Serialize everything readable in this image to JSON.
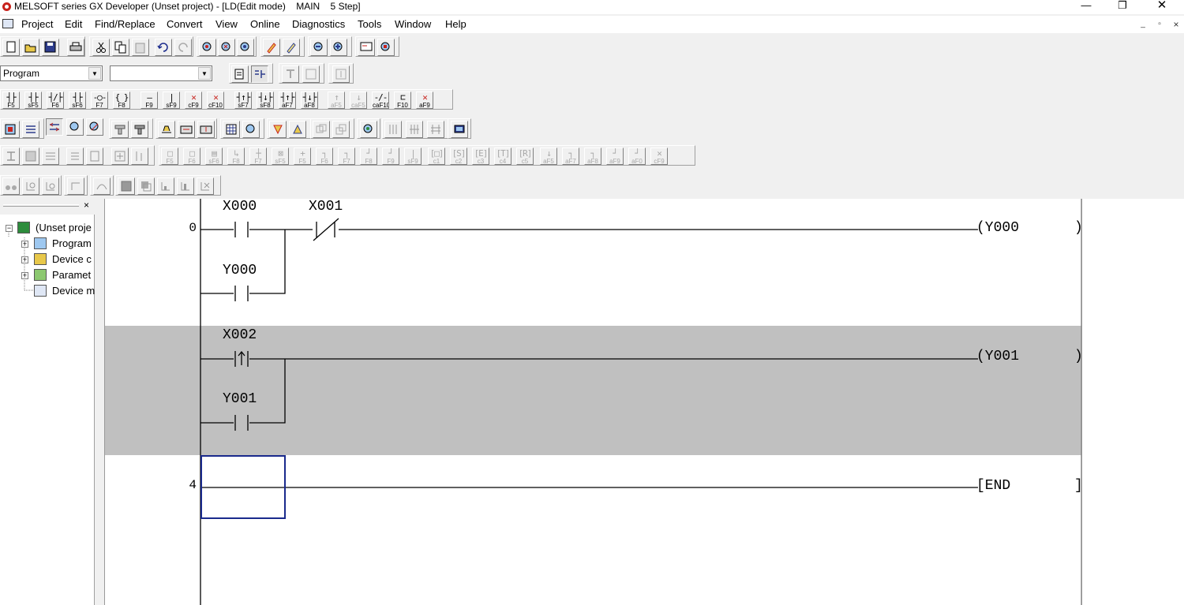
{
  "window": {
    "title": "MELSOFT series GX Developer (Unset project) - [LD(Edit mode)    MAIN    5 Step]",
    "minimize": "—",
    "restore": "❐",
    "close": "✕",
    "mdi_minimize": "_",
    "mdi_restore": "▫",
    "mdi_close": "×"
  },
  "menu": [
    "Project",
    "Edit",
    "Find/Replace",
    "Convert",
    "View",
    "Online",
    "Diagnostics",
    "Tools",
    "Window",
    "Help"
  ],
  "toolbar_combo": {
    "program_value": "Program",
    "second_value": "",
    "arrow": "▼"
  },
  "ladder_keys": [
    {
      "glyph": "┤├",
      "key": "F5"
    },
    {
      "glyph": "┤├",
      "key": "sF5"
    },
    {
      "glyph": "┤/├",
      "key": "F6"
    },
    {
      "glyph": "┤├",
      "key": "sF6"
    },
    {
      "glyph": "-○-",
      "key": "F7"
    },
    {
      "glyph": "{ }",
      "key": "F8"
    },
    {
      "glyph": "—",
      "key": "F9"
    },
    {
      "glyph": "|",
      "key": "sF9"
    },
    {
      "glyph": "✕",
      "key": "cF9"
    },
    {
      "glyph": "✕",
      "key": "cF10"
    },
    {
      "glyph": "┤↑├",
      "key": "sF7"
    },
    {
      "glyph": "┤↓├",
      "key": "sF8"
    },
    {
      "glyph": "┤↑├",
      "key": "aF7"
    },
    {
      "glyph": "┤↓├",
      "key": "aF8"
    },
    {
      "glyph": "↑",
      "key": "aF5"
    },
    {
      "glyph": "↓",
      "key": "caF5"
    },
    {
      "glyph": "-/-",
      "key": "caF10"
    },
    {
      "glyph": "⊏",
      "key": "F10"
    },
    {
      "glyph": "✕",
      "key": "aF9"
    }
  ],
  "sfc_keys": [
    "F5",
    "F6",
    "sF6",
    "F8",
    "F7",
    "sF5",
    "F5",
    "F6",
    "F7",
    "F8",
    "F9",
    "sF9",
    "c1",
    "c2",
    "c3",
    "c4",
    "c5",
    "aF5",
    "aF7",
    "aF8",
    "aF9",
    "aF0",
    "cF9"
  ],
  "tree": {
    "close": "×",
    "root": "(Unset proje",
    "children": [
      "Program",
      "Device c",
      "Paramet",
      "Device m"
    ],
    "expand": "+",
    "collapse": "−"
  },
  "ladder": {
    "rungs": [
      {
        "step": "0",
        "contacts": [
          {
            "label": "X000",
            "type": "NO"
          },
          {
            "label": "X001",
            "type": "NC"
          },
          {
            "label": "Y000",
            "type": "NO",
            "branch": true
          }
        ],
        "coil": "(Y000",
        "coil_end": ")"
      },
      {
        "step": "",
        "contacts": [
          {
            "label": "X002",
            "type": "rising"
          },
          {
            "label": "Y001",
            "type": "NO",
            "branch": true
          }
        ],
        "coil": "(Y001",
        "coil_end": ")"
      },
      {
        "step": "4",
        "coil": "[END",
        "coil_end": "]"
      }
    ]
  }
}
